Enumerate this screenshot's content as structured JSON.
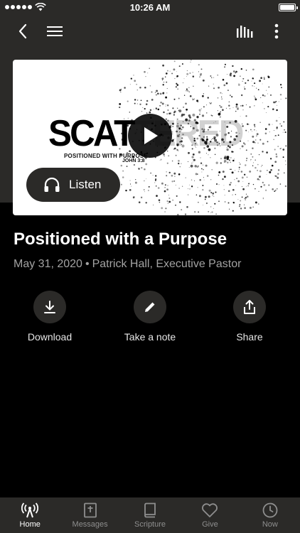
{
  "status": {
    "time": "10:26 AM"
  },
  "artwork": {
    "title_solid": "SCAT",
    "title_faded": "TERED",
    "subtitle": "POSITIONED WITH PURPOSE",
    "reference": "JOHN 3:8"
  },
  "listen_label": "Listen",
  "sermon": {
    "title": "Positioned with a Purpose",
    "date": "May 31, 2020",
    "speaker": "Patrick Hall, Executive Pastor"
  },
  "actions": [
    {
      "label": "Download",
      "icon": "download-icon"
    },
    {
      "label": "Take a note",
      "icon": "pencil-icon"
    },
    {
      "label": "Share",
      "icon": "share-icon"
    }
  ],
  "tabs": [
    {
      "label": "Home",
      "icon": "broadcast-icon",
      "active": true
    },
    {
      "label": "Messages",
      "icon": "bible-cross-icon",
      "active": false
    },
    {
      "label": "Scripture",
      "icon": "book-icon",
      "active": false
    },
    {
      "label": "Give",
      "icon": "heart-icon",
      "active": false
    },
    {
      "label": "Now",
      "icon": "clock-icon",
      "active": false
    }
  ],
  "colors": {
    "background": "#000000",
    "surface": "#2b2a28",
    "muted_text": "#a3a3a3"
  }
}
